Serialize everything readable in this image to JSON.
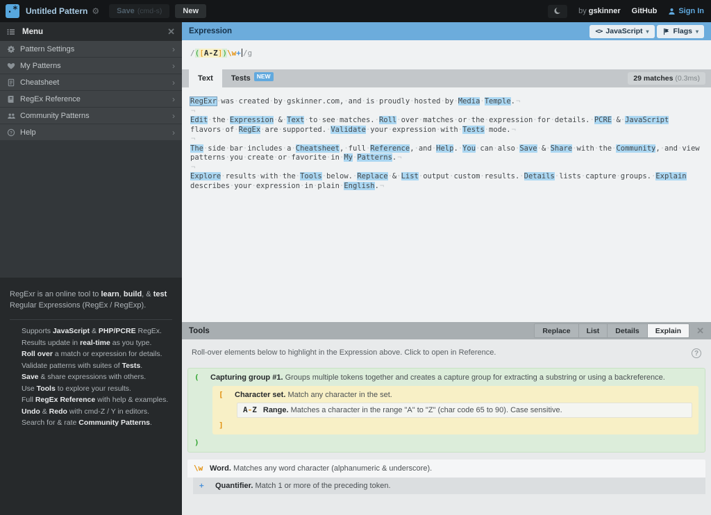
{
  "topbar": {
    "logo": ".*",
    "title": "Untitled Pattern",
    "save_label": "Save",
    "save_hint": "(cmd-s)",
    "new_label": "New",
    "by_label": "by",
    "author": "gskinner",
    "github": "GitHub",
    "signin": "Sign In"
  },
  "sidebar": {
    "menu_title": "Menu",
    "items": [
      {
        "icon": "gear-icon",
        "label": "Pattern Settings"
      },
      {
        "icon": "heart-icon",
        "label": "My Patterns"
      },
      {
        "icon": "cheatsheet-icon",
        "label": "Cheatsheet"
      },
      {
        "icon": "reference-icon",
        "label": "RegEx Reference"
      },
      {
        "icon": "community-icon",
        "label": "Community Patterns"
      },
      {
        "icon": "help-icon",
        "label": "Help"
      }
    ],
    "about": {
      "intro": [
        {
          "t": "RegExr is an online tool to "
        },
        {
          "t": "learn",
          "b": true
        },
        {
          "t": ", "
        },
        {
          "t": "build",
          "b": true
        },
        {
          "t": ", & "
        },
        {
          "t": "test",
          "b": true
        },
        {
          "t": " Regular Expressions (RegEx / RegExp)."
        }
      ],
      "bullets": [
        [
          {
            "t": "Supports "
          },
          {
            "t": "JavaScript",
            "b": true
          },
          {
            "t": " & "
          },
          {
            "t": "PHP/PCRE",
            "b": true
          },
          {
            "t": " RegEx."
          }
        ],
        [
          {
            "t": "Results update in "
          },
          {
            "t": "real-time",
            "b": true
          },
          {
            "t": " as you type."
          }
        ],
        [
          {
            "t": "Roll over",
            "b": true
          },
          {
            "t": " a match or expression for details."
          }
        ],
        [
          {
            "t": "Validate patterns with suites of "
          },
          {
            "t": "Tests",
            "b": true
          },
          {
            "t": "."
          }
        ],
        [
          {
            "t": "Save",
            "b": true
          },
          {
            "t": " & share expressions with others."
          }
        ],
        [
          {
            "t": "Use "
          },
          {
            "t": "Tools",
            "b": true
          },
          {
            "t": " to explore your results."
          }
        ],
        [
          {
            "t": "Full "
          },
          {
            "t": "RegEx Reference",
            "b": true
          },
          {
            "t": " with help & examples."
          }
        ],
        [
          {
            "t": "Undo",
            "b": true
          },
          {
            "t": " & "
          },
          {
            "t": "Redo",
            "b": true
          },
          {
            "t": " with cmd-Z / Y in editors."
          }
        ],
        [
          {
            "t": "Search for & rate "
          },
          {
            "t": "Community Patterns",
            "b": true
          },
          {
            "t": "."
          }
        ]
      ]
    }
  },
  "expression": {
    "panel_title": "Expression",
    "lang_button": "JavaScript",
    "flags_button": "Flags",
    "tokens": [
      {
        "t": "/",
        "cls": "delim"
      },
      {
        "t": "(",
        "cls": "group"
      },
      {
        "t": "[",
        "cls": "setb"
      },
      {
        "t": "A-Z",
        "cls": "range"
      },
      {
        "t": "]",
        "cls": "setb"
      },
      {
        "t": ")",
        "cls": "group"
      },
      {
        "t": "\\w",
        "cls": "escape"
      },
      {
        "t": "+",
        "cls": "quant"
      },
      {
        "t": "",
        "cls": "cursor"
      },
      {
        "t": "/g",
        "cls": "delim"
      }
    ]
  },
  "tabs": {
    "text": "Text",
    "tests": "Tests",
    "new_badge": "NEW",
    "matches": "29 matches",
    "time": "(0.3ms)"
  },
  "text_panel": {
    "paragraphs": [
      {
        "lines": [
          [
            {
              "t": "RegExr",
              "m": true,
              "sel": true
            },
            {
              "t": " was created by gskinner.com, and is proudly hosted by "
            },
            {
              "t": "Media",
              "m": true
            },
            {
              "t": " "
            },
            {
              "t": "Temple",
              "m": true
            },
            {
              "t": "."
            }
          ]
        ]
      },
      {
        "lines": [
          [
            {
              "t": "Edit",
              "m": true
            },
            {
              "t": " the "
            },
            {
              "t": "Expression",
              "m": true
            },
            {
              "t": " & "
            },
            {
              "t": "Text",
              "m": true
            },
            {
              "t": " to see matches. "
            },
            {
              "t": "Roll",
              "m": true
            },
            {
              "t": " over matches or the expression for details. "
            },
            {
              "t": "PCRE",
              "m": true
            },
            {
              "t": " & "
            },
            {
              "t": "JavaScript",
              "m": true
            }
          ],
          [
            {
              "t": "flavors of "
            },
            {
              "t": "RegEx",
              "m": true
            },
            {
              "t": " are supported. "
            },
            {
              "t": "Validate",
              "m": true
            },
            {
              "t": " your expression with "
            },
            {
              "t": "Tests",
              "m": true
            },
            {
              "t": " mode."
            }
          ]
        ]
      },
      {
        "lines": [
          [
            {
              "t": "The",
              "m": true
            },
            {
              "t": " side bar includes a "
            },
            {
              "t": "Cheatsheet",
              "m": true
            },
            {
              "t": ", full "
            },
            {
              "t": "Reference",
              "m": true
            },
            {
              "t": ", and "
            },
            {
              "t": "Help",
              "m": true
            },
            {
              "t": ". "
            },
            {
              "t": "You",
              "m": true
            },
            {
              "t": " can also "
            },
            {
              "t": "Save",
              "m": true
            },
            {
              "t": " & "
            },
            {
              "t": "Share",
              "m": true
            },
            {
              "t": " with the "
            },
            {
              "t": "Community",
              "m": true
            },
            {
              "t": ", and view"
            }
          ],
          [
            {
              "t": "patterns you create or favorite in "
            },
            {
              "t": "My",
              "m": true
            },
            {
              "t": " "
            },
            {
              "t": "Patterns",
              "m": true
            },
            {
              "t": "."
            }
          ]
        ]
      },
      {
        "lines": [
          [
            {
              "t": "Explore",
              "m": true
            },
            {
              "t": " results with the "
            },
            {
              "t": "Tools",
              "m": true
            },
            {
              "t": " below. "
            },
            {
              "t": "Replace",
              "m": true
            },
            {
              "t": " & "
            },
            {
              "t": "List",
              "m": true
            },
            {
              "t": " output custom results. "
            },
            {
              "t": "Details",
              "m": true
            },
            {
              "t": " lists capture groups. "
            },
            {
              "t": "Explain",
              "m": true
            }
          ],
          [
            {
              "t": "describes your expression in plain "
            },
            {
              "t": "English",
              "m": true
            },
            {
              "t": "."
            }
          ]
        ]
      }
    ]
  },
  "tools": {
    "panel_title": "Tools",
    "tabs": [
      "Replace",
      "List",
      "Details",
      "Explain"
    ],
    "active_tab": "Explain",
    "info": "Roll-over elements below to highlight in the Expression above. Click to open in Reference.",
    "explain": {
      "group": {
        "open": "(",
        "close": ")",
        "title": "Capturing group #1.",
        "desc": "Groups multiple tokens together and creates a capture group for extracting a substring or using a backreference.",
        "charset": {
          "open": "[",
          "close": "]",
          "title": "Character set.",
          "desc": "Match any character in the set.",
          "range": {
            "a": "A",
            "dash": "-",
            "z": "Z",
            "title": "Range.",
            "desc": "Matches a character in the range \"A\" to \"Z\" (char code 65 to 90). Case sensitive."
          }
        }
      },
      "word": {
        "token": "\\w",
        "title": "Word.",
        "desc": "Matches any word character (alphanumeric & underscore)."
      },
      "quant": {
        "token": "+",
        "title": "Quantifier.",
        "desc": "Match 1 or more of the preceding token."
      }
    }
  }
}
